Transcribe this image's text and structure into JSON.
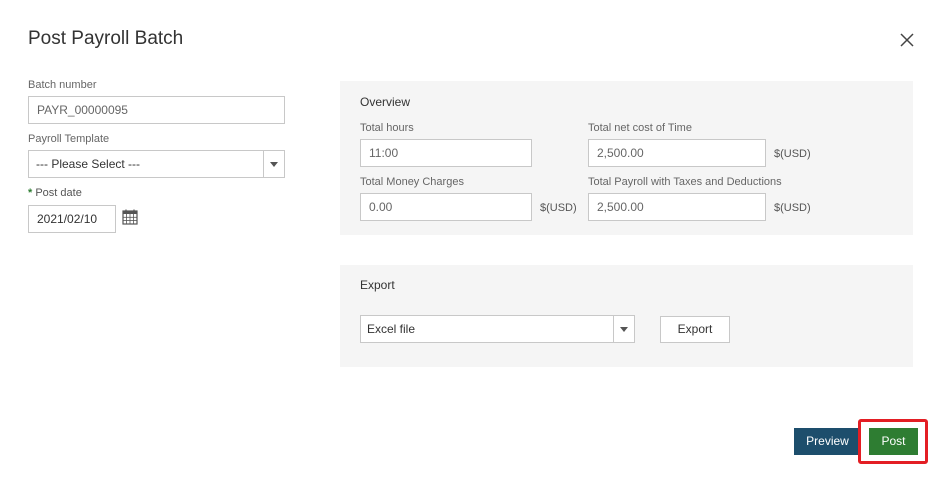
{
  "dialog": {
    "title": "Post Payroll Batch"
  },
  "form": {
    "batch_number_label": "Batch number",
    "batch_number_value": "PAYR_00000095",
    "template_label": "Payroll Template",
    "template_value": "--- Please Select ---",
    "post_date_required": "*",
    "post_date_label": "Post date",
    "post_date_value": "2021/02/10"
  },
  "overview": {
    "title": "Overview",
    "total_hours_label": "Total hours",
    "total_hours_value": "11:00",
    "net_cost_label": "Total net cost of Time",
    "net_cost_value": "2,500.00",
    "net_cost_unit": "$(USD)",
    "money_charges_label": "Total Money Charges",
    "money_charges_value": "0.00",
    "money_charges_unit": "$(USD)",
    "payroll_total_label": "Total Payroll with Taxes and Deductions",
    "payroll_total_value": "2,500.00",
    "payroll_total_unit": "$(USD)"
  },
  "export": {
    "title": "Export",
    "format_value": "Excel file",
    "button_label": "Export"
  },
  "actions": {
    "preview_label": "Preview",
    "post_label": "Post"
  },
  "colors": {
    "post_button": "#2e7d32",
    "preview_button": "#1d4e6c",
    "highlight": "#e31e24",
    "panel_bg": "#f5f5f5"
  }
}
